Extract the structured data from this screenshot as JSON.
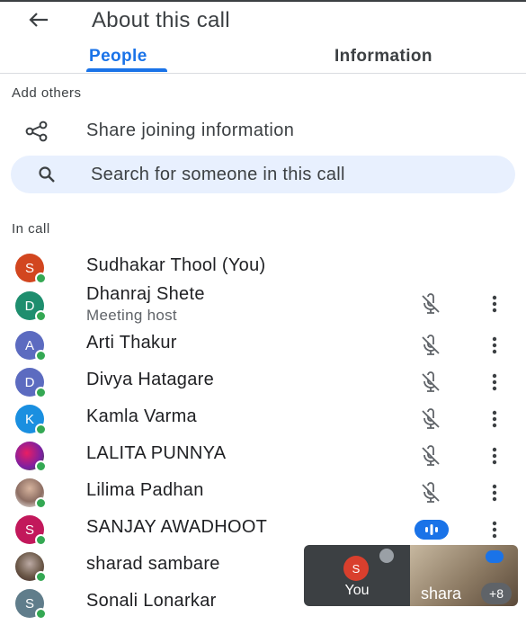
{
  "header": {
    "title": "About this call",
    "back_icon": "arrow-left-icon"
  },
  "tabs": [
    {
      "label": "People",
      "active": true
    },
    {
      "label": "Information",
      "active": false
    }
  ],
  "add_others": {
    "label": "Add others",
    "share_label": "Share joining information",
    "share_icon": "share-icon"
  },
  "search": {
    "placeholder": "Search for someone in this call",
    "icon": "search-icon"
  },
  "in_call": {
    "label": "In call",
    "people": [
      {
        "initial": "S",
        "name": "Sudhakar Thool (You)",
        "color": "#d2461f"
      },
      {
        "initial": "D",
        "name": "Dhanraj Shete",
        "subtitle": "Meeting host",
        "color": "#1e8e6e"
      },
      {
        "initial": "A",
        "name": "Arti Thakur",
        "color": "#5c6bc0"
      },
      {
        "initial": "D",
        "name": "Divya Hatagare",
        "color": "#5c6bc0"
      },
      {
        "initial": "K",
        "name": "Kamla Varma",
        "color": "#1a8fe0"
      },
      {
        "initial": "",
        "name": "LALITA PUNNYA",
        "color": "#c2185b"
      },
      {
        "initial": "",
        "name": "Lilima Padhan",
        "color": "#a1887f"
      },
      {
        "initial": "S",
        "name": "SANJAY AWADHOOT",
        "color": "#c2185b"
      },
      {
        "initial": "",
        "name": "sharad sambare",
        "color": "#6d5a4a"
      },
      {
        "initial": "S",
        "name": "Sonali Lonarkar",
        "color": "#607d8b"
      }
    ]
  },
  "tiles": {
    "you": {
      "initial": "S",
      "label": "You"
    },
    "other": {
      "label": "shara"
    },
    "overflow": "+8"
  },
  "colors": {
    "accent": "#1a73e8",
    "online": "#34a853"
  }
}
